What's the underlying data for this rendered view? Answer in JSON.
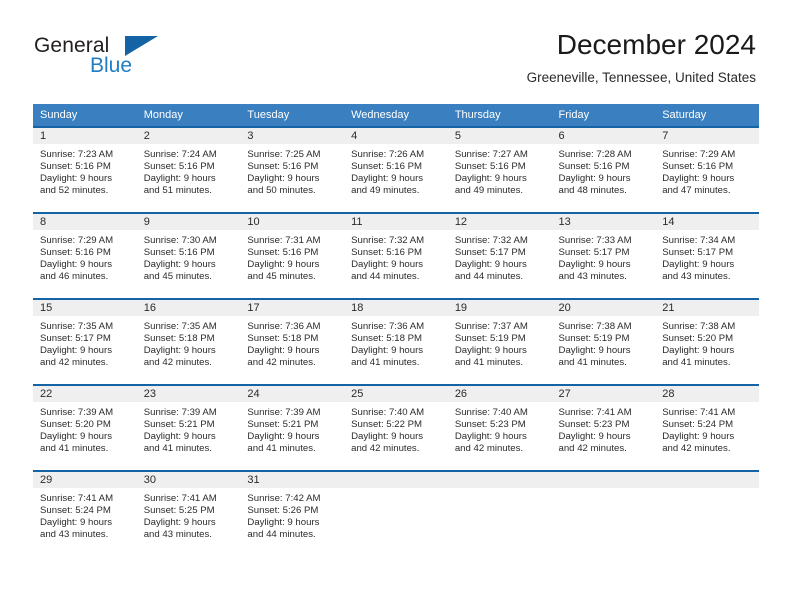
{
  "brand": {
    "name_primary": "General",
    "name_secondary": "Blue",
    "logo_icon": "triangle-logo-icon"
  },
  "header": {
    "month_title": "December 2024",
    "location": "Greeneville, Tennessee, United States"
  },
  "calendar": {
    "weekday_headers": [
      "Sunday",
      "Monday",
      "Tuesday",
      "Wednesday",
      "Thursday",
      "Friday",
      "Saturday"
    ],
    "header_bg": "#3a7fbf",
    "row_divider_color": "#1464a5",
    "daynum_bg": "#efefef",
    "weeks": [
      [
        {
          "day": "1",
          "sunrise": "Sunrise: 7:23 AM",
          "sunset": "Sunset: 5:16 PM",
          "daylight_line1": "Daylight: 9 hours",
          "daylight_line2": "and 52 minutes."
        },
        {
          "day": "2",
          "sunrise": "Sunrise: 7:24 AM",
          "sunset": "Sunset: 5:16 PM",
          "daylight_line1": "Daylight: 9 hours",
          "daylight_line2": "and 51 minutes."
        },
        {
          "day": "3",
          "sunrise": "Sunrise: 7:25 AM",
          "sunset": "Sunset: 5:16 PM",
          "daylight_line1": "Daylight: 9 hours",
          "daylight_line2": "and 50 minutes."
        },
        {
          "day": "4",
          "sunrise": "Sunrise: 7:26 AM",
          "sunset": "Sunset: 5:16 PM",
          "daylight_line1": "Daylight: 9 hours",
          "daylight_line2": "and 49 minutes."
        },
        {
          "day": "5",
          "sunrise": "Sunrise: 7:27 AM",
          "sunset": "Sunset: 5:16 PM",
          "daylight_line1": "Daylight: 9 hours",
          "daylight_line2": "and 49 minutes."
        },
        {
          "day": "6",
          "sunrise": "Sunrise: 7:28 AM",
          "sunset": "Sunset: 5:16 PM",
          "daylight_line1": "Daylight: 9 hours",
          "daylight_line2": "and 48 minutes."
        },
        {
          "day": "7",
          "sunrise": "Sunrise: 7:29 AM",
          "sunset": "Sunset: 5:16 PM",
          "daylight_line1": "Daylight: 9 hours",
          "daylight_line2": "and 47 minutes."
        }
      ],
      [
        {
          "day": "8",
          "sunrise": "Sunrise: 7:29 AM",
          "sunset": "Sunset: 5:16 PM",
          "daylight_line1": "Daylight: 9 hours",
          "daylight_line2": "and 46 minutes."
        },
        {
          "day": "9",
          "sunrise": "Sunrise: 7:30 AM",
          "sunset": "Sunset: 5:16 PM",
          "daylight_line1": "Daylight: 9 hours",
          "daylight_line2": "and 45 minutes."
        },
        {
          "day": "10",
          "sunrise": "Sunrise: 7:31 AM",
          "sunset": "Sunset: 5:16 PM",
          "daylight_line1": "Daylight: 9 hours",
          "daylight_line2": "and 45 minutes."
        },
        {
          "day": "11",
          "sunrise": "Sunrise: 7:32 AM",
          "sunset": "Sunset: 5:16 PM",
          "daylight_line1": "Daylight: 9 hours",
          "daylight_line2": "and 44 minutes."
        },
        {
          "day": "12",
          "sunrise": "Sunrise: 7:32 AM",
          "sunset": "Sunset: 5:17 PM",
          "daylight_line1": "Daylight: 9 hours",
          "daylight_line2": "and 44 minutes."
        },
        {
          "day": "13",
          "sunrise": "Sunrise: 7:33 AM",
          "sunset": "Sunset: 5:17 PM",
          "daylight_line1": "Daylight: 9 hours",
          "daylight_line2": "and 43 minutes."
        },
        {
          "day": "14",
          "sunrise": "Sunrise: 7:34 AM",
          "sunset": "Sunset: 5:17 PM",
          "daylight_line1": "Daylight: 9 hours",
          "daylight_line2": "and 43 minutes."
        }
      ],
      [
        {
          "day": "15",
          "sunrise": "Sunrise: 7:35 AM",
          "sunset": "Sunset: 5:17 PM",
          "daylight_line1": "Daylight: 9 hours",
          "daylight_line2": "and 42 minutes."
        },
        {
          "day": "16",
          "sunrise": "Sunrise: 7:35 AM",
          "sunset": "Sunset: 5:18 PM",
          "daylight_line1": "Daylight: 9 hours",
          "daylight_line2": "and 42 minutes."
        },
        {
          "day": "17",
          "sunrise": "Sunrise: 7:36 AM",
          "sunset": "Sunset: 5:18 PM",
          "daylight_line1": "Daylight: 9 hours",
          "daylight_line2": "and 42 minutes."
        },
        {
          "day": "18",
          "sunrise": "Sunrise: 7:36 AM",
          "sunset": "Sunset: 5:18 PM",
          "daylight_line1": "Daylight: 9 hours",
          "daylight_line2": "and 41 minutes."
        },
        {
          "day": "19",
          "sunrise": "Sunrise: 7:37 AM",
          "sunset": "Sunset: 5:19 PM",
          "daylight_line1": "Daylight: 9 hours",
          "daylight_line2": "and 41 minutes."
        },
        {
          "day": "20",
          "sunrise": "Sunrise: 7:38 AM",
          "sunset": "Sunset: 5:19 PM",
          "daylight_line1": "Daylight: 9 hours",
          "daylight_line2": "and 41 minutes."
        },
        {
          "day": "21",
          "sunrise": "Sunrise: 7:38 AM",
          "sunset": "Sunset: 5:20 PM",
          "daylight_line1": "Daylight: 9 hours",
          "daylight_line2": "and 41 minutes."
        }
      ],
      [
        {
          "day": "22",
          "sunrise": "Sunrise: 7:39 AM",
          "sunset": "Sunset: 5:20 PM",
          "daylight_line1": "Daylight: 9 hours",
          "daylight_line2": "and 41 minutes."
        },
        {
          "day": "23",
          "sunrise": "Sunrise: 7:39 AM",
          "sunset": "Sunset: 5:21 PM",
          "daylight_line1": "Daylight: 9 hours",
          "daylight_line2": "and 41 minutes."
        },
        {
          "day": "24",
          "sunrise": "Sunrise: 7:39 AM",
          "sunset": "Sunset: 5:21 PM",
          "daylight_line1": "Daylight: 9 hours",
          "daylight_line2": "and 41 minutes."
        },
        {
          "day": "25",
          "sunrise": "Sunrise: 7:40 AM",
          "sunset": "Sunset: 5:22 PM",
          "daylight_line1": "Daylight: 9 hours",
          "daylight_line2": "and 42 minutes."
        },
        {
          "day": "26",
          "sunrise": "Sunrise: 7:40 AM",
          "sunset": "Sunset: 5:23 PM",
          "daylight_line1": "Daylight: 9 hours",
          "daylight_line2": "and 42 minutes."
        },
        {
          "day": "27",
          "sunrise": "Sunrise: 7:41 AM",
          "sunset": "Sunset: 5:23 PM",
          "daylight_line1": "Daylight: 9 hours",
          "daylight_line2": "and 42 minutes."
        },
        {
          "day": "28",
          "sunrise": "Sunrise: 7:41 AM",
          "sunset": "Sunset: 5:24 PM",
          "daylight_line1": "Daylight: 9 hours",
          "daylight_line2": "and 42 minutes."
        }
      ],
      [
        {
          "day": "29",
          "sunrise": "Sunrise: 7:41 AM",
          "sunset": "Sunset: 5:24 PM",
          "daylight_line1": "Daylight: 9 hours",
          "daylight_line2": "and 43 minutes."
        },
        {
          "day": "30",
          "sunrise": "Sunrise: 7:41 AM",
          "sunset": "Sunset: 5:25 PM",
          "daylight_line1": "Daylight: 9 hours",
          "daylight_line2": "and 43 minutes."
        },
        {
          "day": "31",
          "sunrise": "Sunrise: 7:42 AM",
          "sunset": "Sunset: 5:26 PM",
          "daylight_line1": "Daylight: 9 hours",
          "daylight_line2": "and 44 minutes."
        },
        {
          "day": "",
          "sunrise": "",
          "sunset": "",
          "daylight_line1": "",
          "daylight_line2": ""
        },
        {
          "day": "",
          "sunrise": "",
          "sunset": "",
          "daylight_line1": "",
          "daylight_line2": ""
        },
        {
          "day": "",
          "sunrise": "",
          "sunset": "",
          "daylight_line1": "",
          "daylight_line2": ""
        },
        {
          "day": "",
          "sunrise": "",
          "sunset": "",
          "daylight_line1": "",
          "daylight_line2": ""
        }
      ]
    ]
  }
}
